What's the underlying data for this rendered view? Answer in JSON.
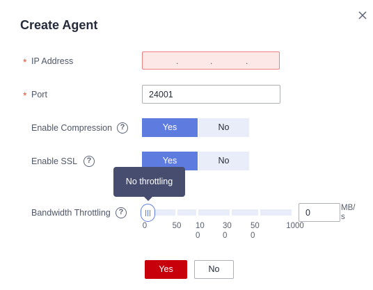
{
  "dialog": {
    "title": "Create Agent",
    "close_icon": "close-icon"
  },
  "ip_address": {
    "required_mark": "*",
    "label": "IP Address",
    "separator": ".",
    "octets": [
      "",
      "",
      "",
      ""
    ],
    "state": "error"
  },
  "port": {
    "required_mark": "*",
    "label": "Port",
    "value": "24001"
  },
  "compression": {
    "label": "Enable Compression",
    "help_icon": "?",
    "options": [
      "Yes",
      "No"
    ],
    "selected": "Yes"
  },
  "ssl": {
    "label": "Enable SSL",
    "help_icon": "?",
    "options": [
      "Yes",
      "No"
    ],
    "selected": "Yes"
  },
  "bandwidth": {
    "label": "Bandwidth Throttling",
    "help_icon": "?",
    "tooltip": "No throttling",
    "tick_labels": [
      {
        "line1": "0",
        "line2": ""
      },
      {
        "line1": "50",
        "line2": ""
      },
      {
        "line1": "10",
        "line2": "0"
      },
      {
        "line1": "30",
        "line2": "0"
      },
      {
        "line1": "50",
        "line2": "0"
      },
      {
        "line1": "1000",
        "line2": ""
      }
    ],
    "slider_value": 0,
    "input_value": "0",
    "unit": "MB/s"
  },
  "footer": {
    "confirm_label": "Yes",
    "cancel_label": "No"
  },
  "colors": {
    "primary": "#5e7ce0",
    "danger": "#c7000b",
    "required": "#e3533b",
    "tooltip_bg": "#464d6e"
  }
}
